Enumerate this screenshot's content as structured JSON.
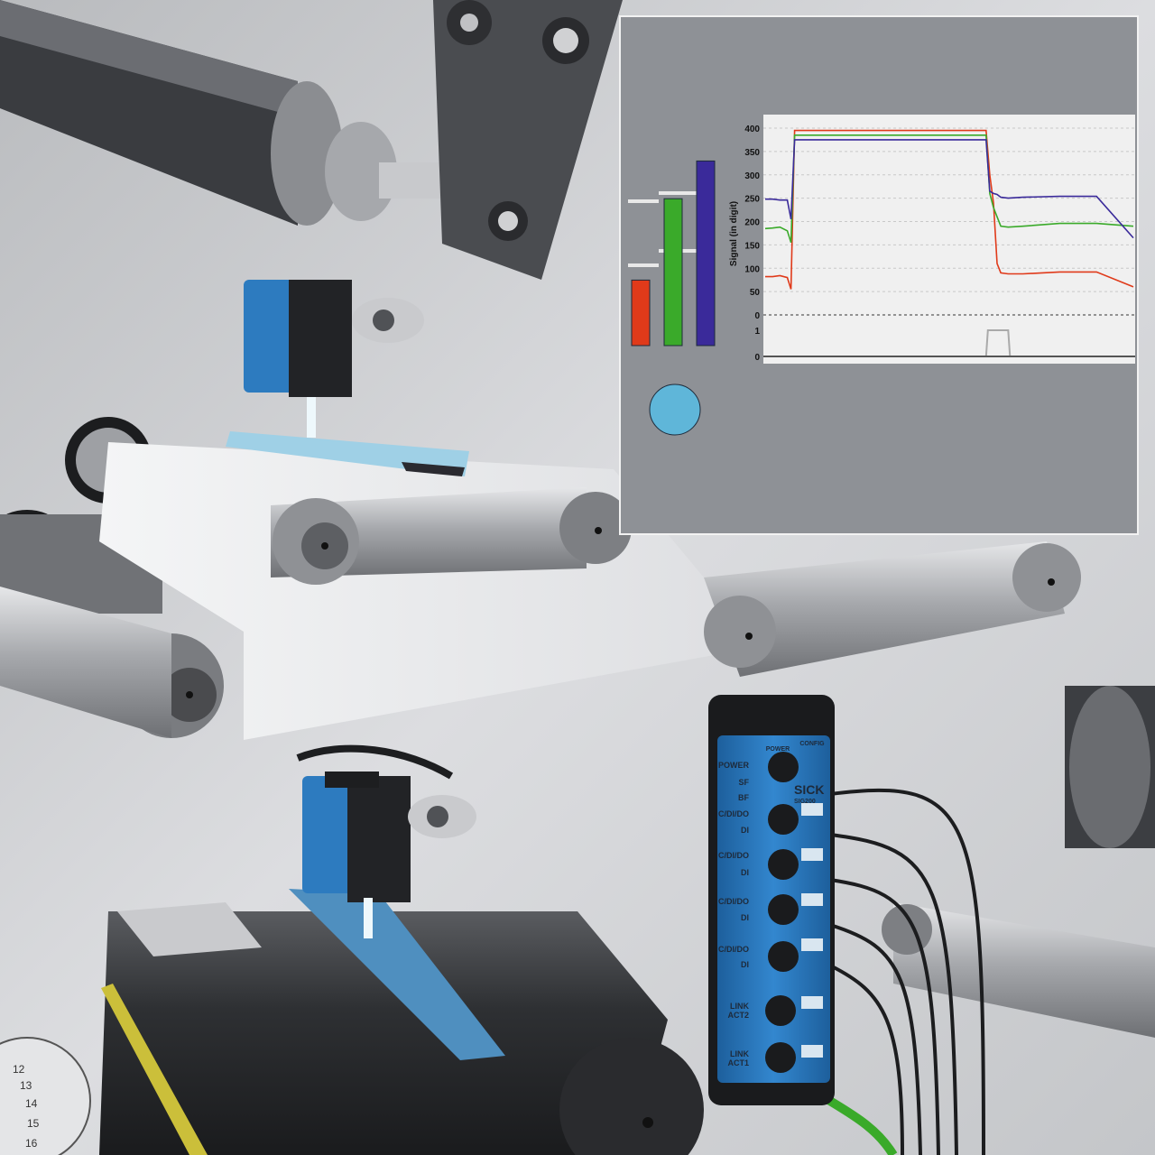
{
  "colors": {
    "red": "#e03a1a",
    "green": "#3aaa2a",
    "blue": "#3a2a9a",
    "panel_bg": "#8e9196",
    "plot_bg": "#f0f0f0",
    "indicator": "#5fb6d9",
    "sensor_blue": "#2f7fc1"
  },
  "icons": [
    "led-indicator-icon"
  ],
  "indicator": {
    "color": "#5fb6d9"
  },
  "bars": {
    "values_fraction": [
      0.33,
      0.74,
      0.93
    ],
    "colors": [
      "#e03a1a",
      "#3aaa2a",
      "#3a2a9a"
    ]
  },
  "chart_data": {
    "type": "line",
    "title": "",
    "xlabel": "",
    "ylabel": "Signal (in digit)",
    "ylim": [
      0,
      400
    ],
    "yticks": [
      400,
      350,
      300,
      250,
      200,
      150,
      100,
      50,
      0
    ],
    "grid": true,
    "x_points": [
      0,
      2,
      4,
      6,
      7,
      8,
      10,
      20,
      40,
      60,
      61,
      62,
      63,
      64,
      66,
      70,
      80,
      90,
      100
    ],
    "series": [
      {
        "color": "#e03a1a",
        "values": [
          82,
          82,
          84,
          80,
          55,
          395,
          395,
          395,
          395,
          395,
          300,
          240,
          110,
          90,
          88,
          88,
          92,
          92,
          60
        ]
      },
      {
        "color": "#3aaa2a",
        "values": [
          185,
          186,
          188,
          180,
          155,
          385,
          385,
          385,
          385,
          385,
          260,
          230,
          210,
          190,
          188,
          190,
          196,
          196,
          190
        ]
      },
      {
        "color": "#3a2a9a",
        "values": [
          248,
          248,
          246,
          246,
          205,
          375,
          375,
          375,
          375,
          375,
          265,
          260,
          258,
          252,
          250,
          252,
          254,
          254,
          165
        ]
      }
    ],
    "digital": {
      "ylim": [
        0,
        1
      ],
      "yticks": [
        1,
        0
      ],
      "x_points": [
        0,
        60,
        60.5,
        66,
        66.5,
        100
      ],
      "values": [
        0,
        0,
        1,
        1,
        0,
        0
      ]
    }
  },
  "hub": {
    "brand": "SICK",
    "model": "SIG200",
    "header_labels": [
      "POWER",
      "CONFIG"
    ],
    "side_labels": [
      "POWER",
      "SF",
      "BF",
      "C/DI/DO",
      "DI",
      "C/DI/DO",
      "DI",
      "C/DI/DO",
      "DI",
      "C/DI/DO",
      "DI",
      "LINK ACT2",
      "LINK ACT1"
    ]
  },
  "dial": {
    "numbers": [
      "12",
      "13",
      "14",
      "15",
      "16"
    ]
  }
}
